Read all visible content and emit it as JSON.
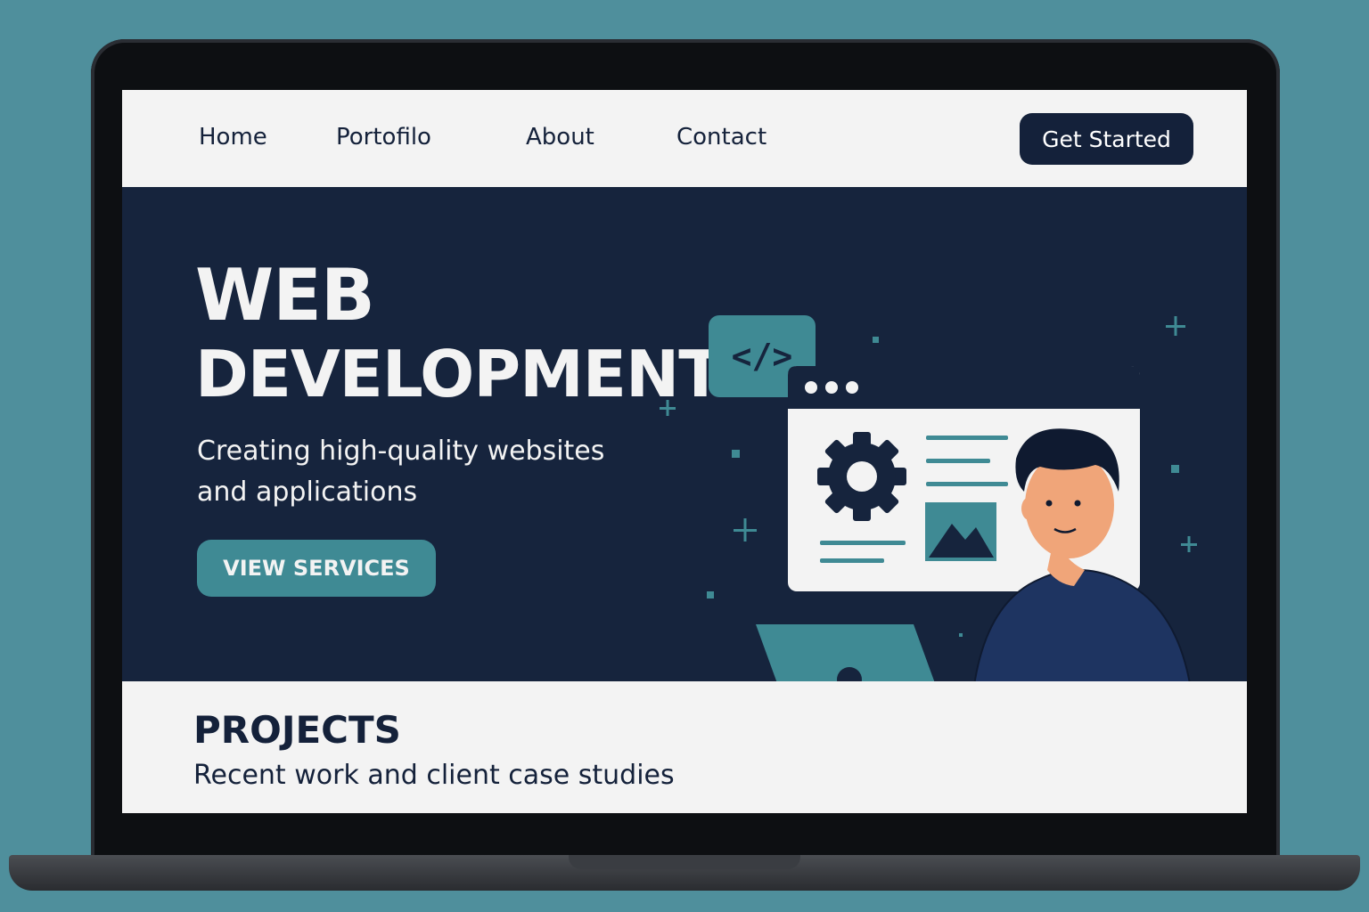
{
  "nav": {
    "links": [
      "Home",
      "Portofilo",
      "About",
      "Contact"
    ],
    "cta_label": "Get Started"
  },
  "hero": {
    "title_line1": "WEB",
    "title_line2": "DEVELOPMENT",
    "subtitle": "Creating high-quality websites and applications",
    "button_label": "VIEW SERVICES",
    "code_badge_text": "</>"
  },
  "projects": {
    "title": "PROJECTS",
    "subtitle": "Recent work and client case studies"
  },
  "colors": {
    "background": "#4f8f9c",
    "navy": "#16243d",
    "accent_teal": "#3f8a94",
    "light": "#f3f3f3"
  },
  "icons": [
    "code-icon",
    "gear-icon",
    "image-icon",
    "laptop-icon",
    "plus-icon"
  ]
}
